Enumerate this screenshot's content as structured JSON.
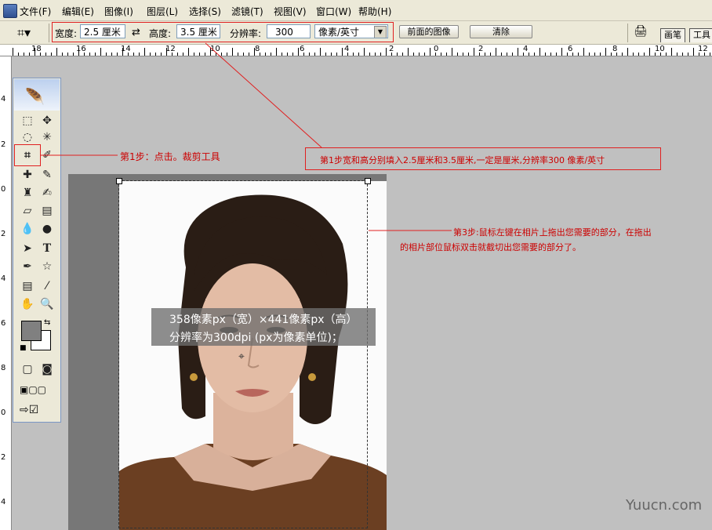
{
  "menu": [
    "文件(F)",
    "编辑(E)",
    "图像(I)",
    "图层(L)",
    "选择(S)",
    "滤镜(T)",
    "视图(V)",
    "窗口(W)",
    "帮助(H)"
  ],
  "options": {
    "width_label": "宽度:",
    "width_value": "2.5 厘米",
    "swap_icon": "⇄",
    "height_label": "高度:",
    "height_value": "3.5 厘米",
    "resolution_label": "分辨率:",
    "resolution_value": "300",
    "unit_value": "像素/英寸",
    "front_image_button": "前面的图像",
    "clear_button": "清除",
    "tabs": [
      "画笔",
      "工具"
    ]
  },
  "ruler": {
    "h_labels": [
      "18",
      "16",
      "14",
      "12",
      "10",
      "8",
      "6",
      "4",
      "2",
      "0",
      "2",
      "4",
      "6",
      "8",
      "10",
      "12"
    ],
    "v_labels": [
      "4",
      "2",
      "0",
      "2",
      "4",
      "6",
      "8",
      "0",
      "2",
      "4"
    ]
  },
  "annotations": {
    "step1": "第1步：点击。裁剪工具",
    "step2": "第1步宽和高分别填入2.5厘米和3.5厘米,一定是厘米,分辨率300 像素/英寸",
    "step3_line1": "第3步:鼠标左键在相片上拖出您需要的部分，在拖出",
    "step3_line2": "的相片部位鼠标双击就截切出您需要的部分了。"
  },
  "photo_info": {
    "line1": "358像素px（宽）×441像素px（高）",
    "line2": "分辨率为300dpi (px为像素单位)；"
  },
  "watermark": "Yuucn.com"
}
